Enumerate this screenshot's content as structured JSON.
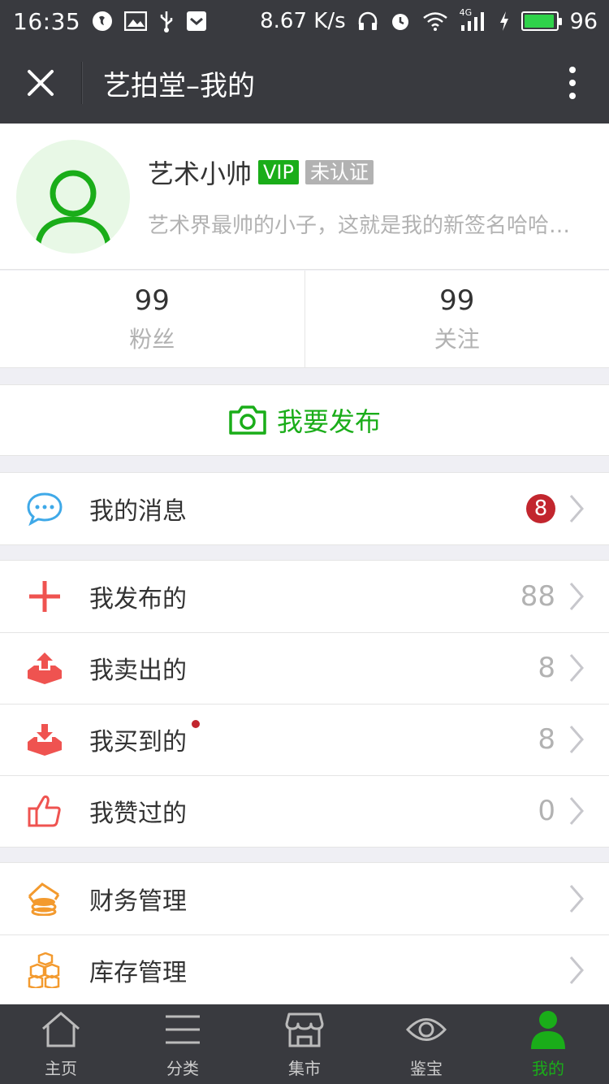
{
  "status_bar": {
    "time": "16:35",
    "speed": "8.67 K/s",
    "network": "4G",
    "battery": "96",
    "battery_level": 0.96
  },
  "nav": {
    "title": "艺拍堂–我的",
    "close_icon": "close-icon",
    "more_icon": "more-vertical-icon"
  },
  "profile": {
    "name": "艺术小帅",
    "vip_badge": "VIP",
    "cert_badge": "未认证",
    "signature": "艺术界最帅的小子，这就是我的新签名哈哈哈哈哈"
  },
  "stats": [
    {
      "value": "99",
      "label": "粉丝"
    },
    {
      "value": "99",
      "label": "关注"
    }
  ],
  "publish": {
    "label": "我要发布",
    "icon": "camera-icon"
  },
  "messages": {
    "label": "我的消息",
    "badge": "8",
    "icon": "chat-bubble-icon"
  },
  "activity": [
    {
      "label": "我发布的",
      "count": "88",
      "icon": "plus-icon"
    },
    {
      "label": "我卖出的",
      "count": "8",
      "icon": "upload-tray-icon"
    },
    {
      "label": "我买到的",
      "count": "8",
      "icon": "download-tray-icon",
      "dot": true
    },
    {
      "label": "我赞过的",
      "count": "0",
      "icon": "thumbs-up-icon"
    }
  ],
  "management": [
    {
      "label": "财务管理",
      "icon": "finance-coins-icon"
    },
    {
      "label": "库存管理",
      "icon": "inventory-boxes-icon"
    }
  ],
  "tabs": [
    {
      "label": "主页",
      "icon": "home-icon"
    },
    {
      "label": "分类",
      "icon": "menu-lines-icon"
    },
    {
      "label": "集市",
      "icon": "shop-icon"
    },
    {
      "label": "鉴宝",
      "icon": "eye-icon"
    },
    {
      "label": "我的",
      "icon": "user-icon",
      "active": true
    }
  ],
  "colors": {
    "bar_bg": "#393a3f",
    "accent_green": "#1aad19",
    "badge_red": "#c2262e",
    "icon_red": "#ef5350",
    "icon_blue": "#3fa9e8",
    "icon_orange": "#f39a2e"
  }
}
